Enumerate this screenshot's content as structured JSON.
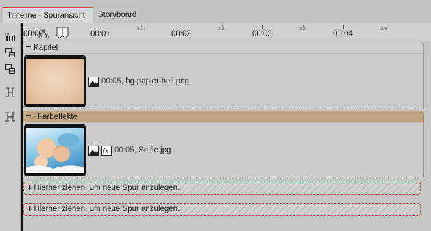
{
  "tabs": [
    {
      "label": "Timeline - Spuransicht"
    },
    {
      "label": "Storyboard"
    }
  ],
  "ruler": {
    "start_label": "00:00",
    "major_labels": [
      "00:01",
      "00:02",
      "00:03",
      "00:04"
    ],
    "minor_label": "500"
  },
  "groups": {
    "kapitel": {
      "label": "Kapitel"
    },
    "farbeffekte": {
      "label": "Farbeffekte"
    }
  },
  "clips": [
    {
      "duration": "00:05,",
      "filename": "hg-papier-hell.png"
    },
    {
      "duration": "00:05,",
      "filename": "Selfie.jpg"
    }
  ],
  "dropzones": [
    {
      "text": "Hierher ziehen, um neue Spur anzulegen."
    },
    {
      "text": "Hierher ziehen, um neue Spur anzulegen."
    }
  ],
  "icons": {
    "toolbar": [
      "zoom-fit-icon",
      "add-track-icon",
      "remove-track-icon",
      "expand-icon",
      "collapse-icon"
    ],
    "clip": [
      "image-icon",
      "fx-icon"
    ]
  },
  "colors": {
    "tab_accent": "#d33a2e",
    "fx_group": "#bfa582",
    "dropzone_border": "#c23a3a"
  }
}
